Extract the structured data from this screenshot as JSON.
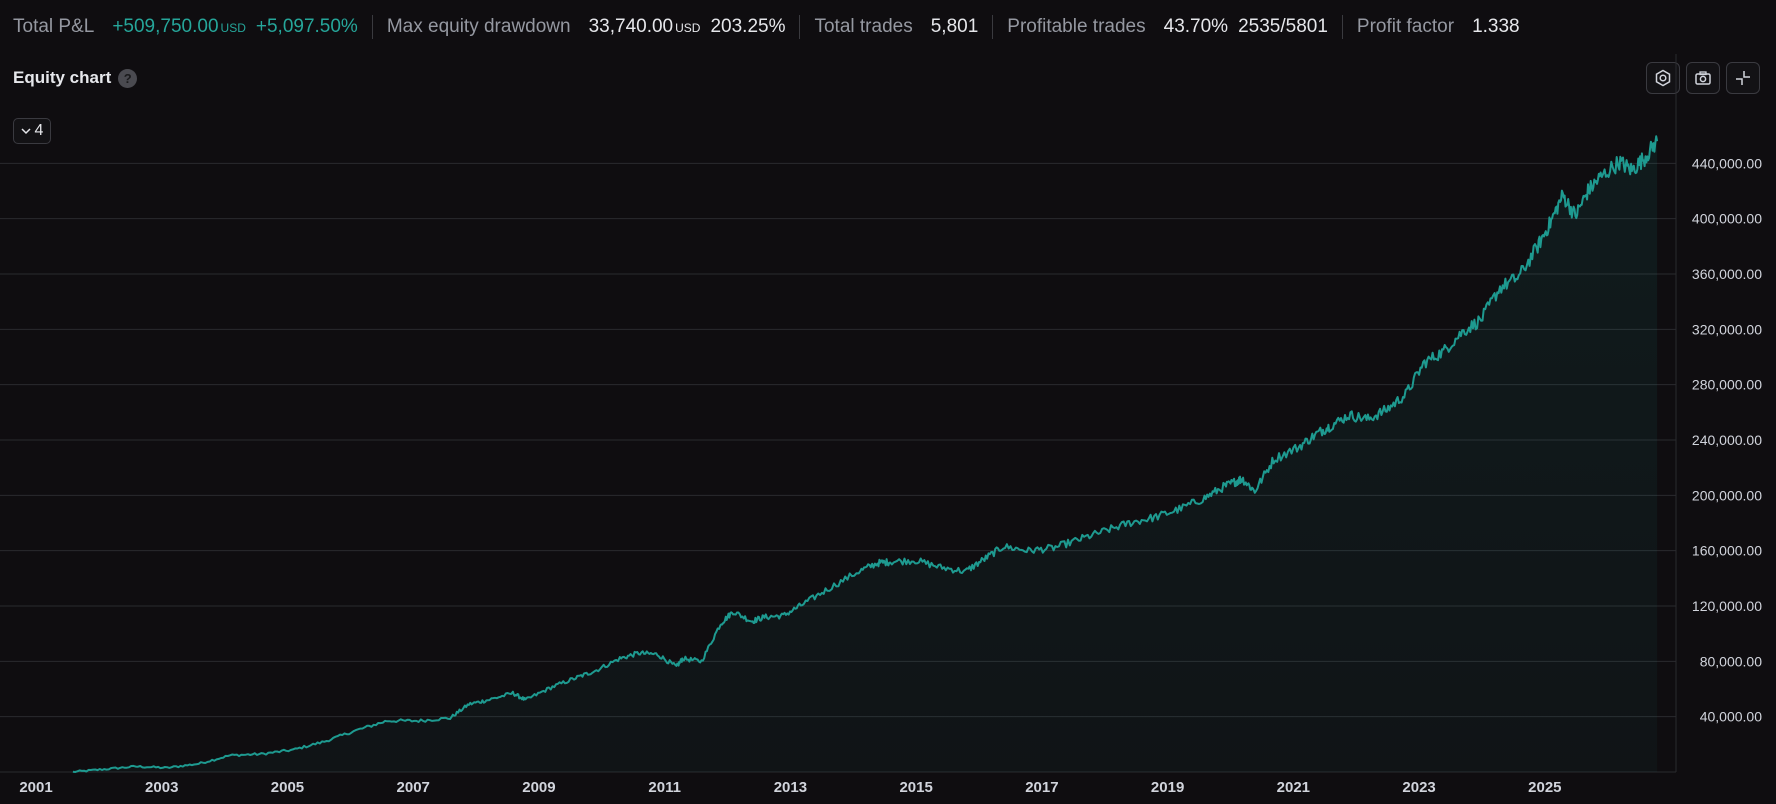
{
  "stats": [
    {
      "label": "Total P&L",
      "values": [
        {
          "text": "+509,750.00",
          "unit": "USD",
          "tone": "pos"
        },
        {
          "text": "+5,097.50%",
          "unit": "",
          "tone": "pos"
        }
      ]
    },
    {
      "label": "Max equity drawdown",
      "values": [
        {
          "text": "33,740.00",
          "unit": "USD",
          "tone": "neutral"
        },
        {
          "text": "203.25%",
          "unit": "",
          "tone": "neutral"
        }
      ]
    },
    {
      "label": "Total trades",
      "values": [
        {
          "text": "5,801",
          "unit": "",
          "tone": "neutral"
        }
      ]
    },
    {
      "label": "Profitable trades",
      "values": [
        {
          "text": "43.70%",
          "unit": "",
          "tone": "neutral"
        },
        {
          "text": "2535/5801",
          "unit": "",
          "tone": "neutral"
        }
      ]
    },
    {
      "label": "Profit factor",
      "values": [
        {
          "text": "1.338",
          "unit": "",
          "tone": "neutral"
        }
      ]
    }
  ],
  "panel": {
    "title": "Equity chart",
    "help_glyph": "?",
    "collapse_value": "4"
  },
  "toolbar": [
    {
      "name": "settings-icon"
    },
    {
      "name": "camera-icon"
    },
    {
      "name": "collapse-icon"
    }
  ],
  "colors": {
    "line": "#1e9a90",
    "positive": "#26a69a",
    "grid": "#2a2a2e",
    "background": "#0f0d10"
  },
  "chart_data": {
    "type": "area",
    "x_ticks": [
      "2001",
      "2003",
      "2005",
      "2007",
      "2009",
      "2011",
      "2013",
      "2015",
      "2017",
      "2019",
      "2021",
      "2023",
      "2025"
    ],
    "y_ticks": [
      "40,000.00",
      "80,000.00",
      "120,000.00",
      "160,000.00",
      "200,000.00",
      "240,000.00",
      "280,000.00",
      "320,000.00",
      "360,000.00",
      "400,000.00",
      "440,000.00"
    ],
    "ylim": [
      0,
      480000
    ],
    "xlim": [
      2001,
      2027.5
    ],
    "series": [
      {
        "x": [
          2002.0,
          2002.5,
          2003.0,
          2003.5,
          2004.0,
          2004.5,
          2005.0,
          2005.5,
          2006.0,
          2006.5,
          2007.0,
          2007.5,
          2008.0,
          2008.3,
          2008.6,
          2009.0,
          2009.2,
          2009.6,
          2010.0,
          2010.3,
          2010.7,
          2011.0,
          2011.3,
          2011.6,
          2011.7,
          2012.0,
          2012.3,
          2012.5,
          2012.8,
          2013.0,
          2013.3,
          2013.6,
          2014.0,
          2014.5,
          2014.8,
          2015.0,
          2015.4,
          2015.8,
          2016.2,
          2016.5,
          2016.8,
          2017.2,
          2017.6,
          2018.0,
          2018.4,
          2018.8,
          2019.2,
          2019.6,
          2020.0,
          2020.3,
          2020.5,
          2020.6,
          2020.8,
          2021.1,
          2021.5,
          2021.8,
          2022.0,
          2022.3,
          2022.6,
          2022.9,
          2023.2,
          2023.5,
          2023.8,
          2024.1,
          2024.4,
          2024.7,
          2025.0,
          2025.3,
          2025.5,
          2025.7,
          2025.9,
          2026.1,
          2026.3,
          2026.6,
          2026.8,
          2027.0,
          2027.2
        ],
        "y": [
          0,
          2000,
          4000,
          3000,
          6000,
          12000,
          13000,
          16000,
          22000,
          30000,
          37000,
          37000,
          39000,
          49000,
          52000,
          57000,
          52000,
          61000,
          68000,
          73000,
          82000,
          86000,
          85000,
          76000,
          82000,
          80000,
          107000,
          116000,
          109000,
          112000,
          113000,
          121000,
          132000,
          145000,
          151000,
          152000,
          153000,
          148000,
          145000,
          154000,
          163000,
          160000,
          162000,
          168000,
          174000,
          180000,
          184000,
          190000,
          198000,
          206000,
          210000,
          212000,
          203000,
          226000,
          235000,
          245000,
          250000,
          258000,
          255000,
          262000,
          273000,
          296000,
          304000,
          318000,
          327000,
          350000,
          358000,
          380000,
          397000,
          417000,
          402000,
          420000,
          430000,
          441000,
          435000,
          444000,
          456000
        ]
      }
    ]
  }
}
